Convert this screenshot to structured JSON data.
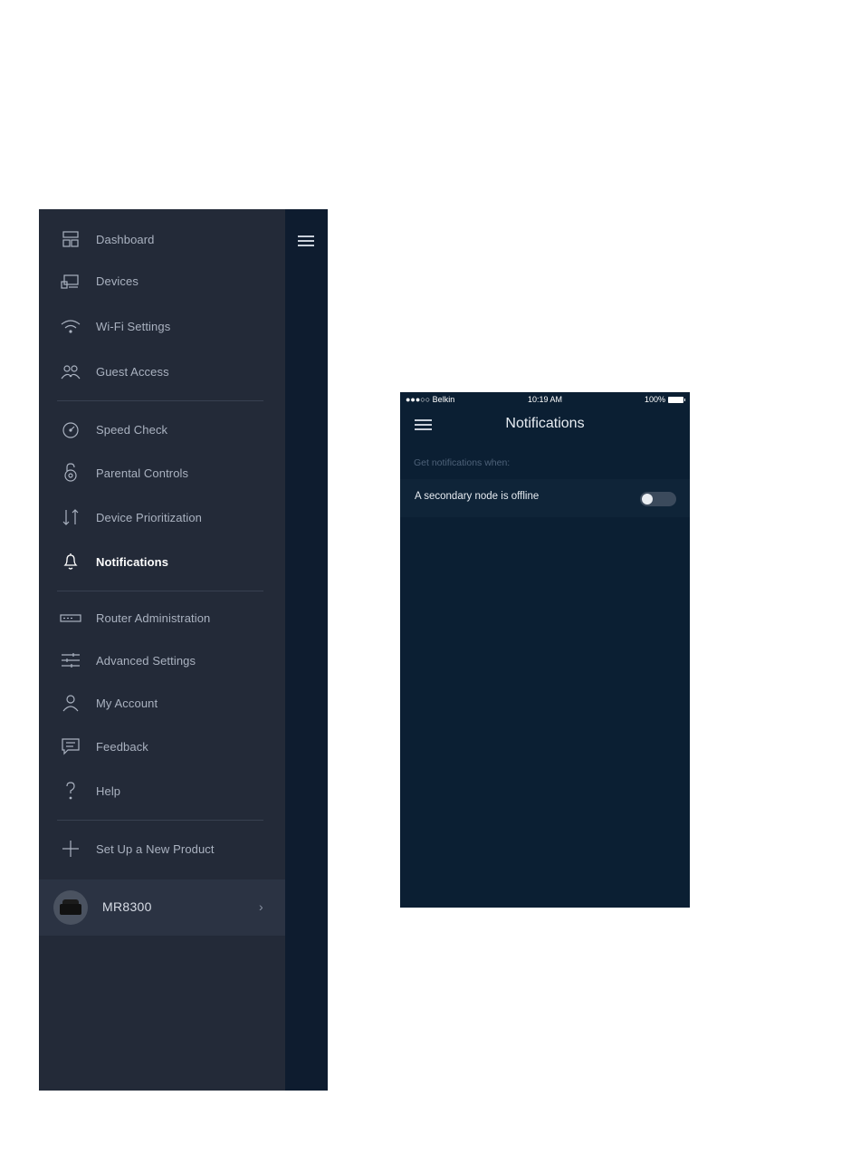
{
  "side_menu": {
    "items": [
      {
        "label": "Dashboard",
        "icon": "dashboard-icon"
      },
      {
        "label": "Devices",
        "icon": "devices-icon"
      },
      {
        "label": "Wi-Fi Settings",
        "icon": "wifi-icon"
      },
      {
        "label": "Guest Access",
        "icon": "guest-access-icon"
      },
      {
        "label": "Speed Check",
        "icon": "speed-check-icon"
      },
      {
        "label": "Parental Controls",
        "icon": "parental-controls-icon"
      },
      {
        "label": "Device Prioritization",
        "icon": "prioritization-icon"
      },
      {
        "label": "Notifications",
        "icon": "bell-icon",
        "active": true
      },
      {
        "label": "Router Administration",
        "icon": "router-icon"
      },
      {
        "label": "Advanced Settings",
        "icon": "sliders-icon"
      },
      {
        "label": "My Account",
        "icon": "account-icon"
      },
      {
        "label": "Feedback",
        "icon": "feedback-icon"
      },
      {
        "label": "Help",
        "icon": "help-icon"
      },
      {
        "label": "Set Up a New Product",
        "icon": "plus-icon"
      }
    ],
    "product": {
      "name": "MR8300",
      "chevron": "›"
    }
  },
  "notifications_screen": {
    "status_bar": {
      "carrier": "●●●○○ Belkin",
      "time": "10:19 AM",
      "battery": "100%"
    },
    "title": "Notifications",
    "section_header": "Get notifications when:",
    "rows": [
      {
        "label": "A secondary node is offline",
        "toggle_on": false
      }
    ]
  },
  "colors": {
    "menu_bg": "#232a38",
    "menu_strip": "#0e1c2f",
    "screen_bg": "#0b1f33",
    "active_text": "#ffffff",
    "inactive_text": "#aab2c0"
  }
}
